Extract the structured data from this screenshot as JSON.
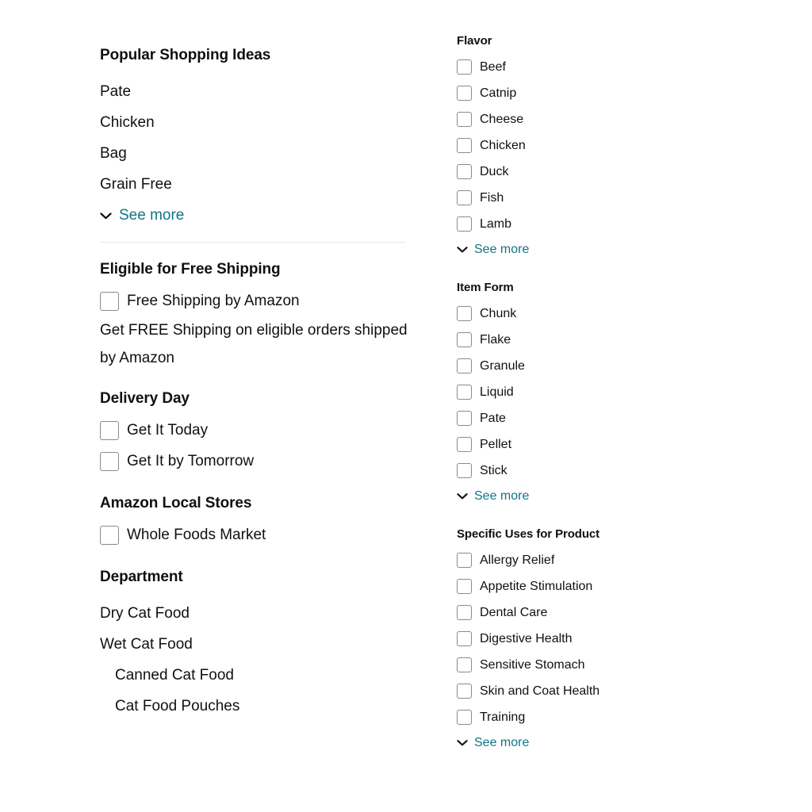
{
  "left_column": {
    "sections": [
      {
        "id": "popular-shopping-ideas",
        "title": "Popular Shopping Ideas",
        "type": "links",
        "items": [
          {
            "label": "Pate",
            "indent": false
          },
          {
            "label": "Chicken",
            "indent": false
          },
          {
            "label": "Bag",
            "indent": false
          },
          {
            "label": "Grain Free",
            "indent": false
          }
        ],
        "see_more": "See more",
        "divider_after": true
      },
      {
        "id": "eligible-for-free-shipping",
        "title": "Eligible for Free Shipping",
        "type": "checkboxes",
        "items": [
          {
            "label": "Free Shipping by Amazon",
            "checked": false
          }
        ],
        "help_text": "Get FREE Shipping on eligible orders shipped by Amazon"
      },
      {
        "id": "delivery-day",
        "title": "Delivery Day",
        "type": "checkboxes",
        "items": [
          {
            "label": "Get It Today",
            "checked": false
          },
          {
            "label": "Get It by Tomorrow",
            "checked": false
          }
        ]
      },
      {
        "id": "amazon-local-stores",
        "title": "Amazon Local Stores",
        "type": "checkboxes",
        "items": [
          {
            "label": "Whole Foods Market",
            "checked": false
          }
        ]
      },
      {
        "id": "department",
        "title": "Department",
        "type": "links",
        "items": [
          {
            "label": "Dry Cat Food",
            "indent": false
          },
          {
            "label": "Wet Cat Food",
            "indent": false
          },
          {
            "label": "Canned Cat Food",
            "indent": true
          },
          {
            "label": "Cat Food Pouches",
            "indent": true
          }
        ]
      }
    ]
  },
  "right_column": {
    "sections": [
      {
        "id": "flavor",
        "title": "Flavor",
        "type": "checkboxes",
        "items": [
          {
            "label": "Beef",
            "checked": false
          },
          {
            "label": "Catnip",
            "checked": false
          },
          {
            "label": "Cheese",
            "checked": false
          },
          {
            "label": "Chicken",
            "checked": false
          },
          {
            "label": "Duck",
            "checked": false
          },
          {
            "label": "Fish",
            "checked": false
          },
          {
            "label": "Lamb",
            "checked": false
          }
        ],
        "see_more": "See more"
      },
      {
        "id": "item-form",
        "title": "Item Form",
        "type": "checkboxes",
        "items": [
          {
            "label": "Chunk",
            "checked": false
          },
          {
            "label": "Flake",
            "checked": false
          },
          {
            "label": "Granule",
            "checked": false
          },
          {
            "label": "Liquid",
            "checked": false
          },
          {
            "label": "Pate",
            "checked": false
          },
          {
            "label": "Pellet",
            "checked": false
          },
          {
            "label": "Stick",
            "checked": false
          }
        ],
        "see_more": "See more"
      },
      {
        "id": "specific-uses-for-product",
        "title": "Specific Uses for Product",
        "type": "checkboxes",
        "items": [
          {
            "label": "Allergy Relief",
            "checked": false
          },
          {
            "label": "Appetite Stimulation",
            "checked": false
          },
          {
            "label": "Dental Care",
            "checked": false
          },
          {
            "label": "Digestive Health",
            "checked": false
          },
          {
            "label": "Sensitive Stomach",
            "checked": false
          },
          {
            "label": "Skin and Coat Health",
            "checked": false
          },
          {
            "label": "Training",
            "checked": false
          }
        ],
        "see_more": "See more"
      }
    ]
  },
  "icons": {
    "chevron_down": "chevron-down-icon",
    "checkbox": "checkbox-icon"
  },
  "colors": {
    "link": "#107585",
    "text": "#0f1111",
    "checkbox_border": "#888c8c",
    "divider": "#e7e7e7",
    "background": "#ffffff"
  }
}
